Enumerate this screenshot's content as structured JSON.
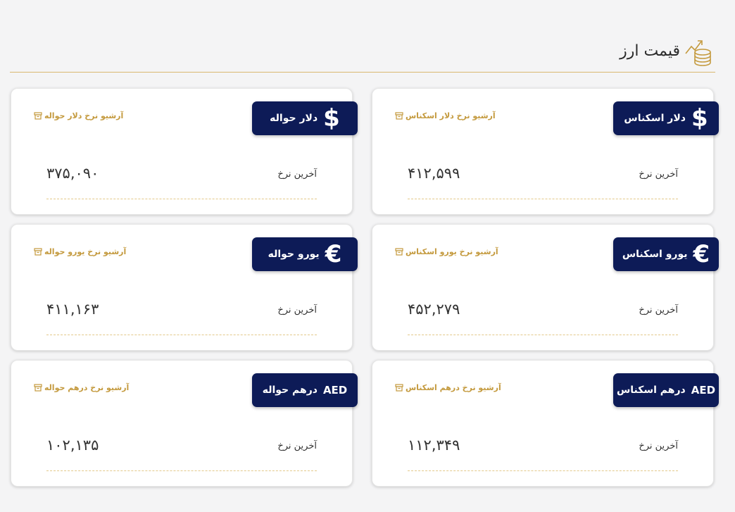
{
  "header": {
    "title": "قیمت ارز",
    "icon": "coins-chart-icon"
  },
  "common": {
    "rate_label": "آخرین نرخ"
  },
  "colors": {
    "badge_bg": "#0d1b57",
    "accent": "#c49a3e",
    "divider": "#d9b770"
  },
  "cards": [
    {
      "badge_icon": "$",
      "badge_label": "دلار اسکناس",
      "archive": "آرشیو نرخ دلار اسکناس",
      "value": "۴۱۲,۵۹۹"
    },
    {
      "badge_icon": "$",
      "badge_label": "دلار حواله",
      "archive": "آرشیو نرخ دلار حواله",
      "value": "۳۷۵,۰۹۰"
    },
    {
      "badge_icon": "€",
      "badge_label": "یورو اسکناس",
      "archive": "آرشیو نرخ یورو اسکناس",
      "value": "۴۵۲,۲۷۹"
    },
    {
      "badge_icon": "€",
      "badge_label": "یورو حواله",
      "archive": "آرشیو نرخ یورو حواله",
      "value": "۴۱۱,۱۶۳"
    },
    {
      "badge_icon": "AED",
      "badge_label": "درهم اسکناس",
      "archive": "آرشیو نرخ درهم اسکناس",
      "value": "۱۱۲,۳۴۹"
    },
    {
      "badge_icon": "AED",
      "badge_label": "درهم حواله",
      "archive": "آرشیو نرخ درهم حواله",
      "value": "۱۰۲,۱۳۵"
    }
  ]
}
